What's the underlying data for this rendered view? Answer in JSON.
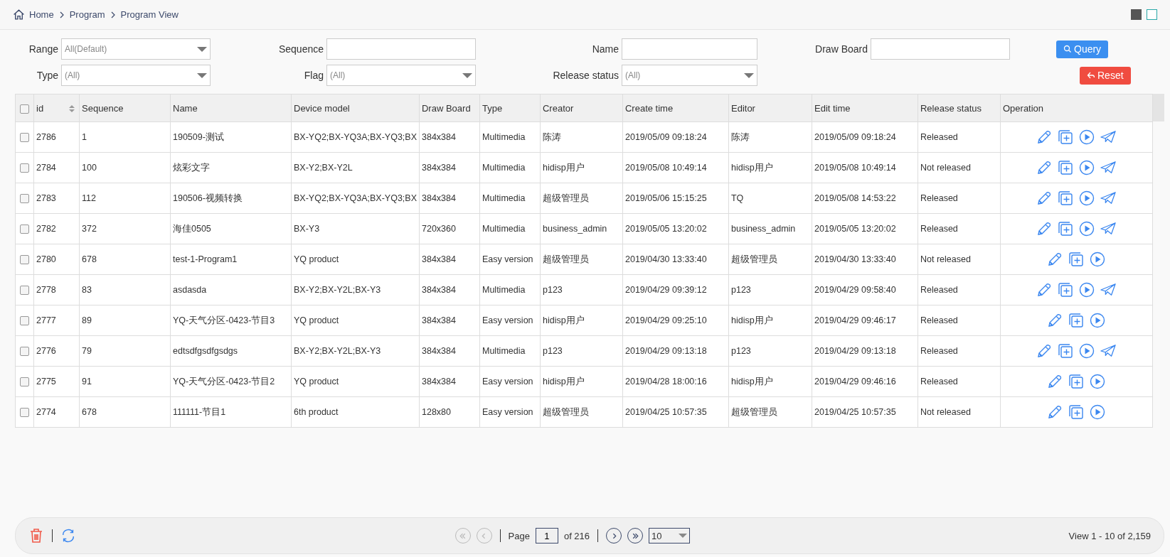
{
  "breadcrumb": [
    "Home",
    "Program",
    "Program View"
  ],
  "filters": [
    {
      "kind": "select",
      "label": "Range",
      "value": "All(Default)"
    },
    {
      "kind": "input",
      "label": "Sequence"
    },
    {
      "kind": "input",
      "label": "Name"
    },
    {
      "kind": "input",
      "label": "Draw Board"
    },
    {
      "kind": "select",
      "label": "Type",
      "value": "(All)"
    },
    {
      "kind": "select",
      "label": "Flag",
      "value": "(All)"
    },
    {
      "kind": "select",
      "label": "Release status",
      "value": "(All)"
    }
  ],
  "query_button": "Query",
  "reset_button": "Reset",
  "table": {
    "select_all_checked": false,
    "columns": [
      "id",
      "Sequence",
      "Name",
      "Device model",
      "Draw Board",
      "Type",
      "Creator",
      "Create time",
      "Editor",
      "Edit time",
      "Release status",
      "Operation"
    ],
    "rows": [
      {
        "checked": false,
        "send": true,
        "cells": [
          "2786",
          "1",
          "190509-测试",
          "BX-YQ2;BX-YQ3A;BX-YQ3;BX",
          "384x384",
          "Multimedia",
          "陈涛",
          "2019/05/09 09:18:24",
          "陈涛",
          "2019/05/09 09:18:24",
          "Released"
        ]
      },
      {
        "checked": false,
        "send": true,
        "cells": [
          "2784",
          "100",
          "炫彩文字",
          "BX-Y2;BX-Y2L",
          "384x384",
          "Multimedia",
          "hidisp用户",
          "2019/05/08 10:49:14",
          "hidisp用户",
          "2019/05/08 10:49:14",
          "Not released"
        ]
      },
      {
        "checked": false,
        "send": true,
        "cells": [
          "2783",
          "112",
          "190506-视频转换",
          "BX-YQ2;BX-YQ3A;BX-YQ3;BX",
          "384x384",
          "Multimedia",
          "超级管理员",
          "2019/05/06 15:15:25",
          "TQ",
          "2019/05/08 14:53:22",
          "Released"
        ]
      },
      {
        "checked": false,
        "send": true,
        "cells": [
          "2782",
          "372",
          "海佳0505",
          "BX-Y3",
          "720x360",
          "Multimedia",
          "business_admin",
          "2019/05/05 13:20:02",
          "business_admin",
          "2019/05/05 13:20:02",
          "Released"
        ]
      },
      {
        "checked": false,
        "send": false,
        "cells": [
          "2780",
          "678",
          "test-1-Program1",
          "YQ product",
          "384x384",
          "Easy version",
          "超级管理员",
          "2019/04/30 13:33:40",
          "超级管理员",
          "2019/04/30 13:33:40",
          "Not released"
        ]
      },
      {
        "checked": false,
        "send": true,
        "cells": [
          "2778",
          "83",
          "asdasda",
          "BX-Y2;BX-Y2L;BX-Y3",
          "384x384",
          "Multimedia",
          "p123",
          "2019/04/29 09:39:12",
          "p123",
          "2019/04/29 09:58:40",
          "Released"
        ]
      },
      {
        "checked": false,
        "send": false,
        "cells": [
          "2777",
          "89",
          "YQ-天气分区-0423-节目3",
          "YQ product",
          "384x384",
          "Easy version",
          "hidisp用户",
          "2019/04/29 09:25:10",
          "hidisp用户",
          "2019/04/29 09:46:17",
          "Released"
        ]
      },
      {
        "checked": false,
        "send": true,
        "cells": [
          "2776",
          "79",
          "edtsdfgsdfgsdgs",
          "BX-Y2;BX-Y2L;BX-Y3",
          "384x384",
          "Multimedia",
          "p123",
          "2019/04/29 09:13:18",
          "p123",
          "2019/04/29 09:13:18",
          "Released"
        ]
      },
      {
        "checked": false,
        "send": false,
        "cells": [
          "2775",
          "91",
          "YQ-天气分区-0423-节目2",
          "YQ product",
          "384x384",
          "Easy version",
          "hidisp用户",
          "2019/04/28 18:00:16",
          "hidisp用户",
          "2019/04/29 09:46:16",
          "Released"
        ]
      },
      {
        "checked": false,
        "send": false,
        "cells": [
          "2774",
          "678",
          "111111-节目1",
          "6th product",
          "128x80",
          "Easy version",
          "超级管理员",
          "2019/04/25 10:57:35",
          "超级管理员",
          "2019/04/25 10:57:35",
          "Not released"
        ]
      }
    ]
  },
  "pager": {
    "first_disabled": true,
    "prev_disabled": true,
    "page_label": "Page",
    "page": "1",
    "of": "of 216",
    "page_size": "10",
    "summary": "View 1 - 10 of 2,159"
  }
}
